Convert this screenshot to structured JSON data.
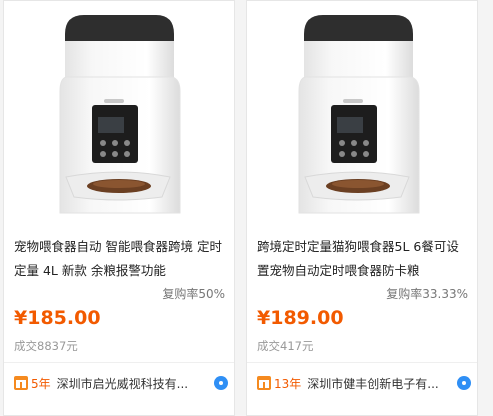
{
  "products": [
    {
      "title": "宠物喂食器自动 智能喂食器跨境 定时定量 4L 新款 余粮报警功能",
      "repurchase": "复购率50%",
      "price": "¥185.00",
      "deals": "成交8837元",
      "years": "5年",
      "company": "深圳市启光威视科技有..."
    },
    {
      "title": "跨境定时定量猫狗喂食器5L 6餐可设置宠物自动定时喂食器防卡粮",
      "repurchase": "复购率33.33%",
      "price": "¥189.00",
      "deals": "成交417元",
      "years": "13年",
      "company": "深圳市健丰创新电子有..."
    }
  ],
  "colors": {
    "price": "#f25a00",
    "gift": "#f58a1f",
    "chat": "#2f8ff5"
  }
}
